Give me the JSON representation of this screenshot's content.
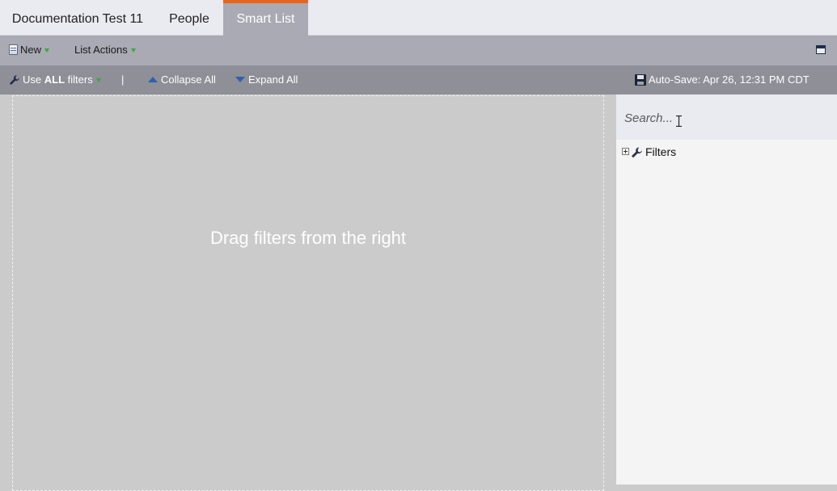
{
  "tabs": {
    "documentation": "Documentation Test 11",
    "people": "People",
    "smart_list": "Smart List",
    "active_color": "#e8651f"
  },
  "toolbar": {
    "new_label": "New",
    "list_actions_label": "List Actions"
  },
  "filter_bar": {
    "use_prefix": "Use",
    "use_all": "ALL",
    "use_suffix": "filters",
    "separator": "|",
    "collapse_all": "Collapse All",
    "expand_all": "Expand All",
    "autosave": "Auto-Save: Apr 26, 12:31 PM CDT"
  },
  "canvas": {
    "hint": "Drag filters from the right"
  },
  "panel": {
    "search_placeholder": "Search...",
    "tree": [
      {
        "label": "Filters",
        "expanded": false
      }
    ]
  },
  "icons": [
    "document-icon",
    "wrench-icon",
    "collapse-icon",
    "expand-icon",
    "save-icon",
    "window-icon",
    "expander-icon",
    "filter-icon",
    "text-cursor-icon"
  ]
}
